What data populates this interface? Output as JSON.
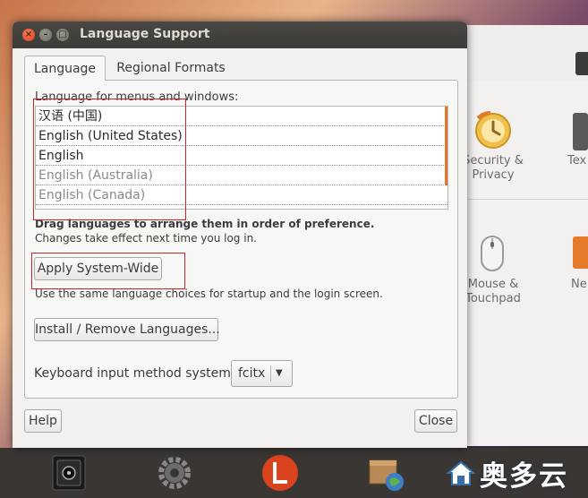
{
  "dialog": {
    "title": "Language Support",
    "window_buttons": {
      "close": "×",
      "minimize": "–",
      "maximize": "□"
    }
  },
  "tabs": [
    {
      "label": "Language",
      "active": true
    },
    {
      "label": "Regional Formats",
      "active": false
    }
  ],
  "language_tab": {
    "section_label": "Language for menus and windows:",
    "languages": [
      {
        "label": "汉语 (中国)",
        "installed": true
      },
      {
        "label": "English (United States)",
        "installed": true
      },
      {
        "label": "English",
        "installed": true
      },
      {
        "label": "English (Australia)",
        "installed": false
      },
      {
        "label": "English (Canada)",
        "installed": false
      }
    ],
    "drag_hint": "Drag languages to arrange them in order of preference.",
    "change_hint": "Changes take effect next time you log in.",
    "apply_button": "Apply System-Wide",
    "apply_description": "Use the same language choices for startup and the login screen.",
    "install_button": "Install / Remove Languages...",
    "keyboard_label": "Keyboard input method system:",
    "keyboard_value": "fcitx"
  },
  "footer": {
    "help_button": "Help",
    "close_button": "Close"
  },
  "background_settings": {
    "items": [
      {
        "label": "Security &\nPrivacy",
        "icon": "security-privacy-icon"
      },
      {
        "label": "Tex",
        "icon": "text-entry-icon"
      },
      {
        "label": "Mouse &\nTouchpad",
        "icon": "mouse-icon"
      },
      {
        "label": "Ne",
        "icon": "network-icon"
      }
    ]
  },
  "dock": {
    "icons": [
      "safe-icon",
      "system-settings-gear-icon",
      "lazarus-app-icon",
      "software-package-icon"
    ]
  },
  "watermark": {
    "text": "奥多云"
  },
  "colors": {
    "accent_orange": "#e4762d",
    "highlight_red": "#d0202a",
    "titlebar": "#3c3b37",
    "close_button": "#d9431d"
  }
}
